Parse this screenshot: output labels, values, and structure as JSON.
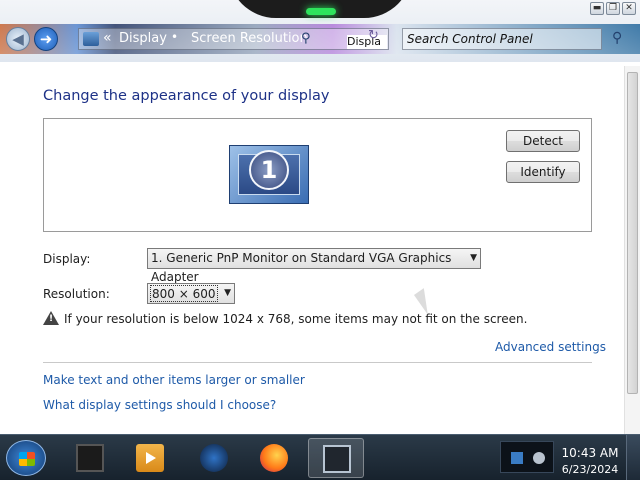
{
  "window": {
    "minimize_glyph": "▬",
    "restore_glyph": "❐",
    "close_glyph": "✕"
  },
  "nav": {
    "back_icon": "◀",
    "forward_icon": "➜",
    "chevron": "«",
    "breadcrumbs": [
      "Display",
      "Screen Resolution"
    ],
    "separator": "•",
    "address_tail": "Displa",
    "search_placeholder": "Search Control Panel",
    "search_icon": "search-icon",
    "refresh_icon": "refresh-icon"
  },
  "main": {
    "title": "Change the appearance of your display",
    "monitor_number": "1",
    "detect_label": "Detect",
    "identify_label": "Identify",
    "display_label": "Display:",
    "display_value": "1. Generic PnP Monitor on Standard VGA Graphics Adapter",
    "resolution_label": "Resolution:",
    "resolution_value": "800 × 600",
    "warning_text": "If your resolution is below 1024 x 768, some items may not fit on the screen.",
    "advanced_link": "Advanced settings",
    "link_larger": "Make text and other items larger or smaller",
    "link_choose": "What display settings should I choose?"
  },
  "taskbar": {
    "time": "10:43 AM",
    "date": "6/23/2024",
    "items": [
      "start-button",
      "display-app",
      "media-player",
      "globe-app",
      "firefox",
      "screen-resolution-window"
    ]
  },
  "colors": {
    "title_blue": "#1e3287",
    "link_blue": "#1e5aa8",
    "taskbar": "#1d2936"
  }
}
